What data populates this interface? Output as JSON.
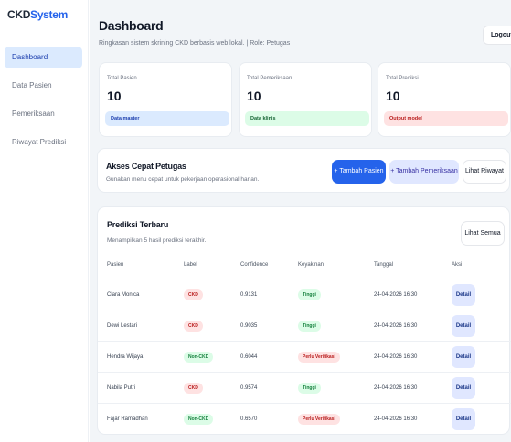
{
  "brand": {
    "prefix": "CKD",
    "suffix": "System"
  },
  "sidebar": {
    "items": [
      {
        "label": "Dashboard",
        "active": true
      },
      {
        "label": "Data Pasien",
        "active": false
      },
      {
        "label": "Pemeriksaan",
        "active": false
      },
      {
        "label": "Riwayat Prediksi",
        "active": false
      }
    ]
  },
  "header": {
    "title": "Dashboard",
    "subtitle": "Ringkasan sistem skrining CKD berbasis web lokal. | Role: Petugas",
    "logout_label": "Logout"
  },
  "stats": [
    {
      "label": "Total Pasien",
      "value": "10",
      "badge": "Data master",
      "badge_bg": "#dbeafe",
      "badge_color": "#1e40af"
    },
    {
      "label": "Total Pemeriksaan",
      "value": "10",
      "badge": "Data klinis",
      "badge_bg": "#dcfce7",
      "badge_color": "#166534"
    },
    {
      "label": "Total Prediksi",
      "value": "10",
      "badge": "Output model",
      "badge_bg": "#fee2e2",
      "badge_color": "#b91c1c"
    }
  ],
  "quick_access": {
    "title": "Akses Cepat Petugas",
    "subtitle": "Gunakan menu cepat untuk pekerjaan operasional harian.",
    "add_patient_label": "+ Tambah Pasien",
    "add_exam_label": "+ Tambah Pemeriksaan",
    "history_label": "Lihat Riwayat"
  },
  "recent": {
    "title": "Prediksi Terbaru",
    "subtitle": "Menampilkan 5 hasil prediksi terakhir.",
    "view_all_label": "Lihat Semua",
    "columns": [
      "Pasien",
      "Label",
      "Confidence",
      "Keyakinan",
      "Tanggal",
      "Aksi"
    ],
    "rows": [
      {
        "patient": "Clara Monica",
        "label": "CKD",
        "label_type": "ckd",
        "confidence": "0.9131",
        "certainty": "Tinggi",
        "certainty_type": "tinggi",
        "date": "24-04-2026 16:30",
        "action": "Detail"
      },
      {
        "patient": "Dewi Lestari",
        "label": "CKD",
        "label_type": "ckd",
        "confidence": "0.9035",
        "certainty": "Tinggi",
        "certainty_type": "tinggi",
        "date": "24-04-2026 16:30",
        "action": "Detail"
      },
      {
        "patient": "Hendra Wijaya",
        "label": "Non-CKD",
        "label_type": "nonckd",
        "confidence": "0.6044",
        "certainty": "Perlu Verifikasi",
        "certainty_type": "perlu",
        "date": "24-04-2026 16:30",
        "action": "Detail"
      },
      {
        "patient": "Nabila Putri",
        "label": "CKD",
        "label_type": "ckd",
        "confidence": "0.9574",
        "certainty": "Tinggi",
        "certainty_type": "tinggi",
        "date": "24-04-2026 16:30",
        "action": "Detail"
      },
      {
        "patient": "Fajar Ramadhan",
        "label": "Non-CKD",
        "label_type": "nonckd",
        "confidence": "0.6570",
        "certainty": "Perlu Verifikasi",
        "certainty_type": "perlu",
        "date": "24-04-2026 16:30",
        "action": "Detail"
      }
    ]
  },
  "colors": {
    "accent": "#2563eb",
    "sidebar_active_bg": "#dbeafe",
    "main_bg": "#f2f5f8"
  }
}
